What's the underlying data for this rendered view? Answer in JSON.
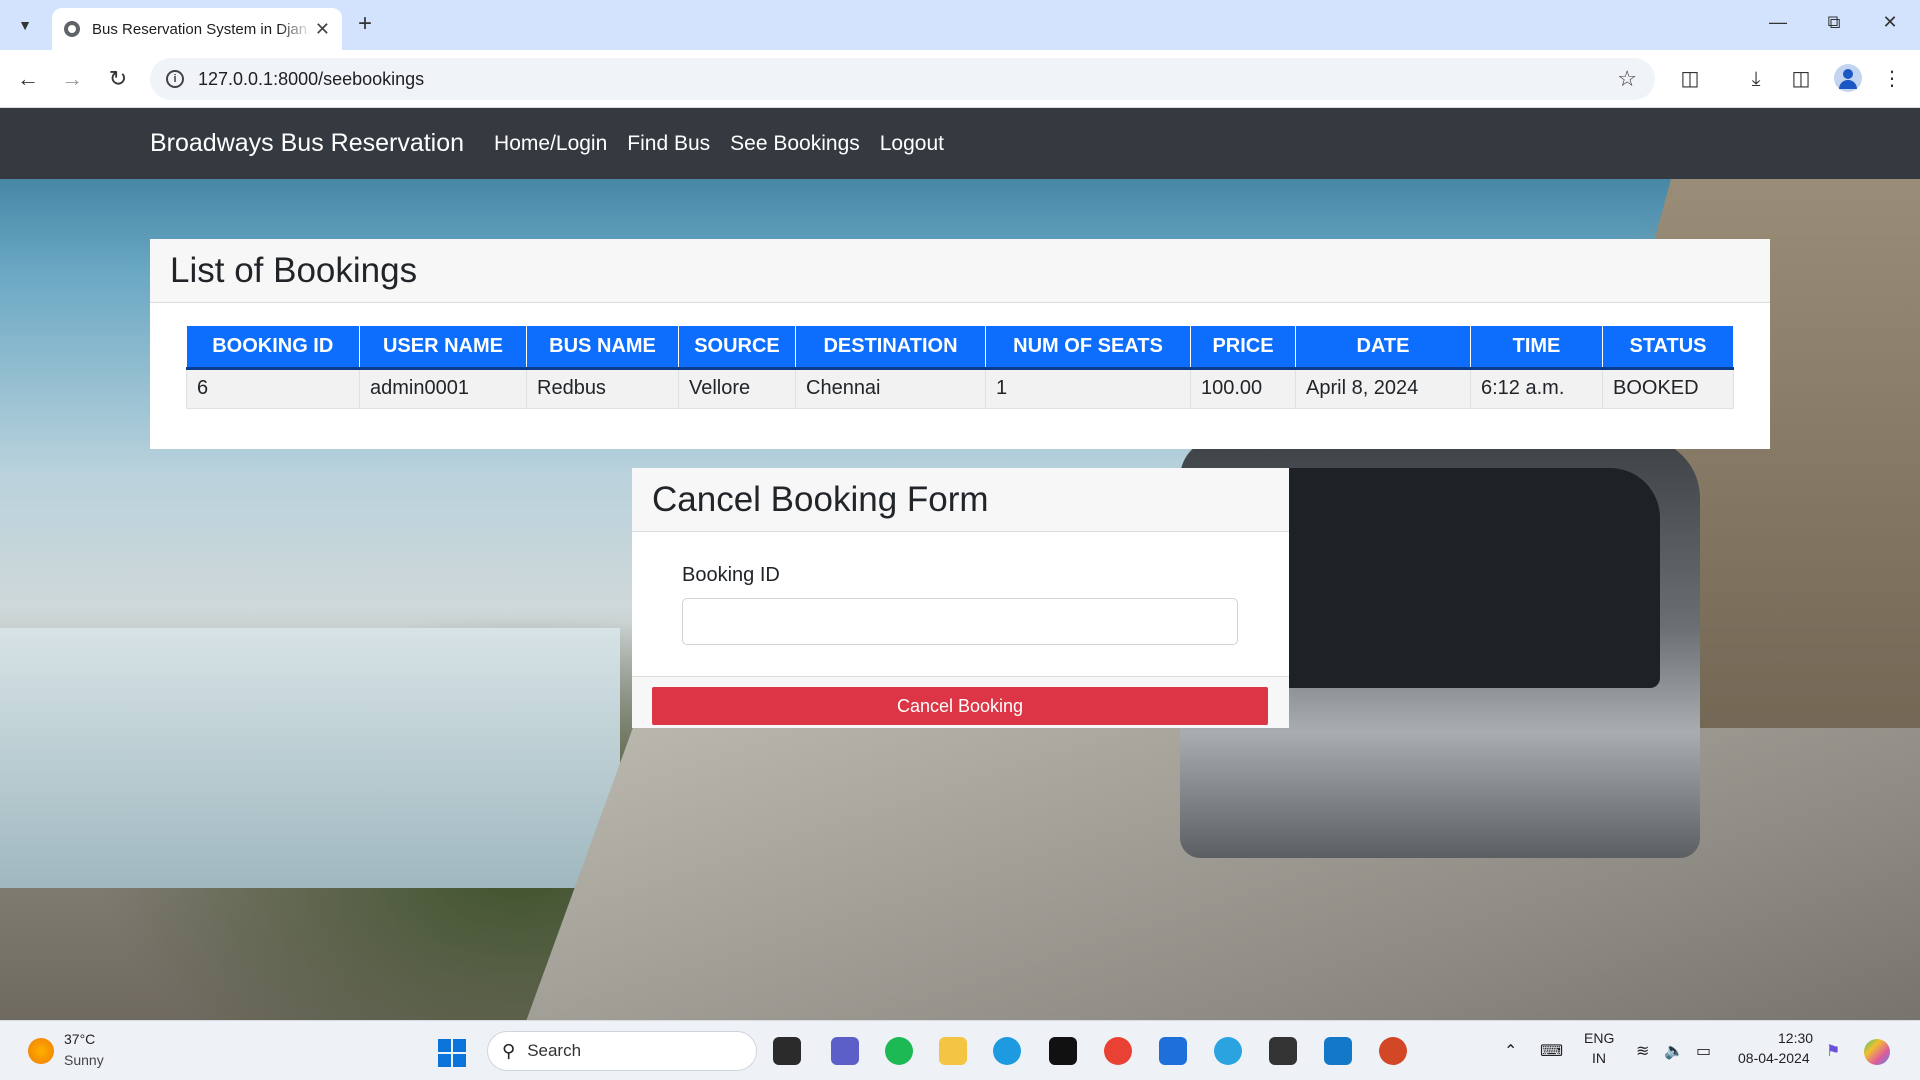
{
  "browser": {
    "tab_title": "Bus Reservation System in Djan",
    "tab_close": "✕",
    "new_tab": "+",
    "url": "127.0.0.1:8000/seebookings"
  },
  "navbar": {
    "brand": "Broadways Bus Reservation",
    "links": [
      "Home/Login",
      "Find Bus",
      "See Bookings",
      "Logout"
    ]
  },
  "bookings_card": {
    "title": "List of Bookings",
    "columns": [
      "BOOKING ID",
      "USER NAME",
      "BUS NAME",
      "SOURCE",
      "DESTINATION",
      "NUM OF SEATS",
      "PRICE",
      "DATE",
      "TIME",
      "STATUS"
    ],
    "rows": [
      [
        "6",
        "admin0001",
        "Redbus",
        "Vellore",
        "Chennai",
        "1",
        "100.00",
        "April 8, 2024",
        "6:12 a.m.",
        "BOOKED"
      ]
    ]
  },
  "cancel_card": {
    "title": "Cancel Booking Form",
    "field_label": "Booking ID",
    "field_value": "",
    "button_label": "Cancel Booking"
  },
  "taskbar": {
    "weather_temp": "37°C",
    "weather_desc": "Sunny",
    "search_placeholder": "Search",
    "lang_line1": "ENG",
    "lang_line2": "IN",
    "time": "12:30",
    "date": "08-04-2024"
  },
  "colors": {
    "navbar_bg": "#343a40",
    "table_header": "#0d6efd",
    "cancel_button": "#dc3545"
  }
}
